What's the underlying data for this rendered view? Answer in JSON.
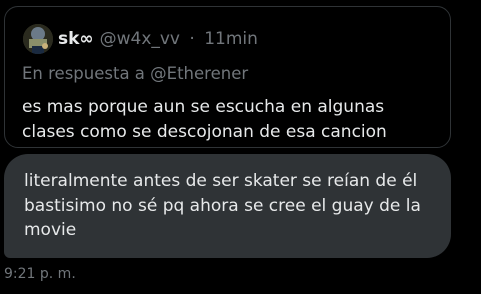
{
  "quoted_post": {
    "author_name": "sk∞",
    "author_handle": "@w4x_vv",
    "separator": "·",
    "time_ago": "11min",
    "reply_context": "En respuesta a @Etherener",
    "text": "es mas porque aun se escucha en algunas clases como se descojonan de esa cancion"
  },
  "message": {
    "text": "literalmente antes de ser skater se reían de él bastisimo no sé pq ahora se cree el guay de la movie",
    "timestamp": "9:21 p. m."
  },
  "colors": {
    "background": "#000000",
    "card_border": "#2f3336",
    "bubble": "#2f3336",
    "text_primary": "#e7e9ea",
    "text_secondary": "#71767b"
  }
}
